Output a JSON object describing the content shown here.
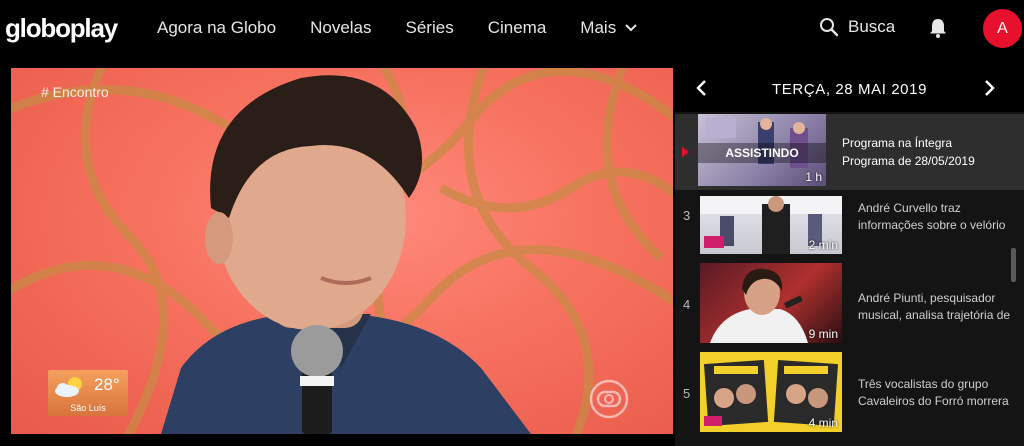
{
  "brand": {
    "logo": "globoplay"
  },
  "nav": {
    "items": [
      {
        "label": "Agora na Globo"
      },
      {
        "label": "Novelas"
      },
      {
        "label": "Séries"
      },
      {
        "label": "Cinema"
      },
      {
        "label": "Mais"
      }
    ],
    "search_label": "Busca",
    "avatar_initial": "A"
  },
  "video": {
    "hashtag": "# Encontro",
    "weather": {
      "temp": "28°",
      "city": "São Luís"
    }
  },
  "panel": {
    "date": "TERÇA, 28 MAI 2019",
    "current": {
      "badge": "ASSISTINDO",
      "duration": "1 h",
      "title": "Programa na Íntegra",
      "subtitle": "Programa de 28/05/2019"
    },
    "items": [
      {
        "number": "3",
        "duration": "2 min",
        "desc_line1": "André Curvello traz",
        "desc_line2": "informações sobre o velório"
      },
      {
        "number": "4",
        "duration": "9 min",
        "desc_line1": "André Piunti, pesquisador",
        "desc_line2": "musical, analisa trajetória de"
      },
      {
        "number": "5",
        "duration": "4 min",
        "desc_line1": "Três vocalistas do grupo",
        "desc_line2": "Cavaleiros do Forró morrera"
      }
    ]
  },
  "colors": {
    "accent": "#e8112d",
    "panel_bg": "#141414",
    "active_row": "#2e2e2e"
  }
}
